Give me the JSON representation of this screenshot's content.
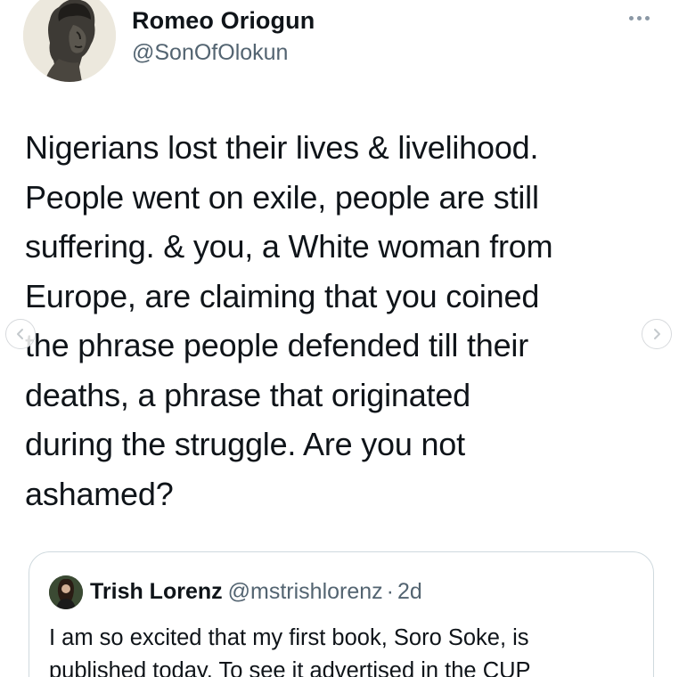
{
  "author": {
    "name": "Romeo Oriogun",
    "handle": "@SonOfOlokun"
  },
  "tweet": {
    "text": "Nigerians lost their lives & livelihood.\nPeople went on exile, people are still\nsuffering. & you, a White woman from\nEurope, are claiming that you coined\nthe phrase people defended till their\ndeaths, a phrase that originated\nduring the struggle. Are you not\nashamed?"
  },
  "quoted": {
    "name": "Trish Lorenz",
    "handle": "@mstrishlorenz",
    "separator": "·",
    "time": "2d",
    "text_line1": "I am so excited that my first book, Soro Soke, is",
    "text_line2": "published today. To see it advertised in the CUP"
  },
  "icons": {
    "more": "more-horizontal-icon",
    "prev": "chevron-left-icon",
    "next": "chevron-right-icon"
  },
  "colors": {
    "text": "#0f1419",
    "secondary": "#536471",
    "border": "#cfd9de"
  }
}
